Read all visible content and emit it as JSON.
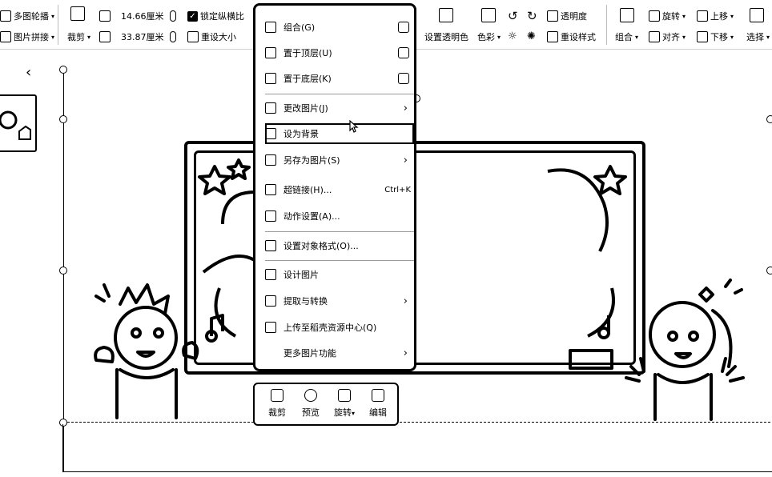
{
  "ribbon": {
    "multi_carousel": "多图轮播",
    "image_splice": "图片拼接",
    "crop": "裁剪",
    "height_value": "14.66厘米",
    "width_value": "33.87厘米",
    "lock_ratio": "锁定纵横比",
    "reset_size": "重设大小",
    "set_transparent_color": "设置透明色",
    "color": "色彩",
    "transparency": "透明度",
    "reset_style": "重设样式",
    "group": "组合",
    "rotate": "旋转",
    "align": "对齐",
    "move_up": "上移",
    "move_down": "下移",
    "select": "选择"
  },
  "context_menu": {
    "items": [
      {
        "label": "组合(G)",
        "icon": "group-icon"
      },
      {
        "label": "置于顶层(U)",
        "icon": "bring-to-front-icon"
      },
      {
        "label": "置于底层(K)",
        "icon": "send-to-back-icon"
      },
      {
        "label": "更改图片(J)",
        "icon": "change-picture-icon"
      },
      {
        "label": "设为背景",
        "icon": "set-background-icon"
      },
      {
        "label": "另存为图片(S)",
        "icon": "save-as-picture-icon"
      },
      {
        "label": "超链接(H)...",
        "icon": "hyperlink-icon",
        "shortcut": "Ctrl+K"
      },
      {
        "label": "动作设置(A)...",
        "icon": "action-settings-icon"
      },
      {
        "label": "设置对象格式(O)...",
        "icon": "format-object-icon"
      },
      {
        "label": "设计图片",
        "icon": "design-picture-icon"
      },
      {
        "label": "提取与转换",
        "icon": "extract-convert-icon"
      },
      {
        "label": "上传至稻壳资源中心(Q)",
        "icon": "upload-icon"
      },
      {
        "label": "更多图片功能",
        "icon": ""
      }
    ]
  },
  "mini_toolbar": {
    "crop": "裁剪",
    "preview": "预览",
    "rotate": "旋转",
    "edit": "编辑"
  }
}
